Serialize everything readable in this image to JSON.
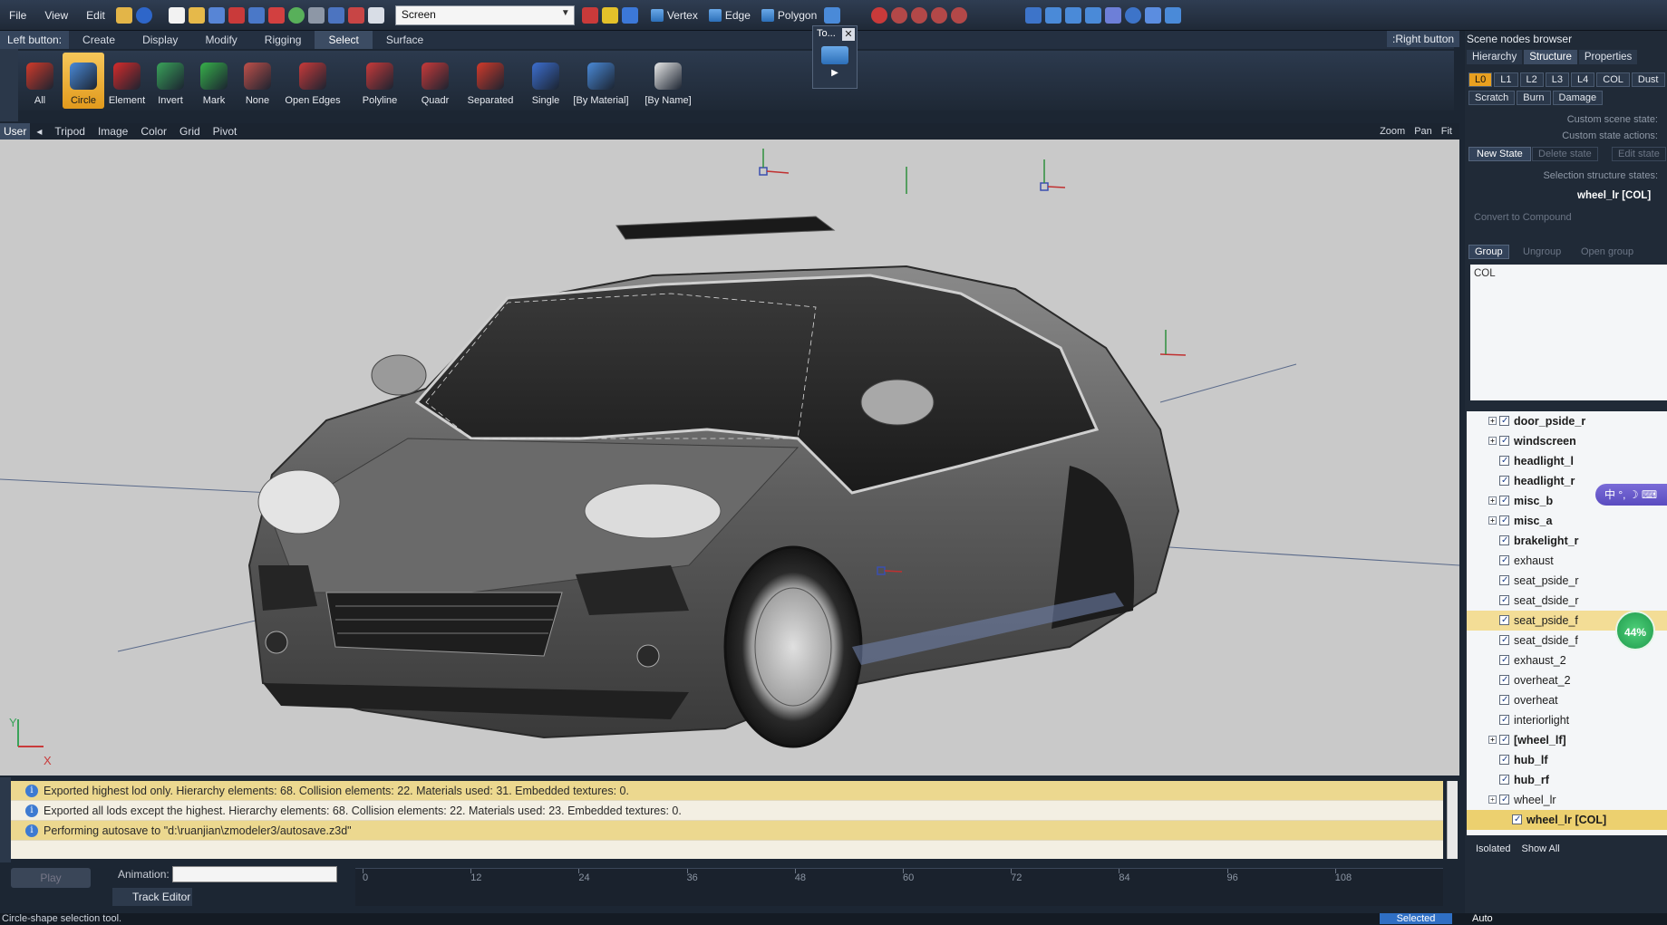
{
  "menu": [
    "File",
    "View",
    "Edit"
  ],
  "toolbar": {
    "screen_value": "Screen",
    "modes": [
      "Vertex",
      "Edge",
      "Polygon"
    ]
  },
  "ribbon": {
    "left_button_label": "Left button:",
    "right_button_label": ":Right button",
    "tabs": [
      "Create",
      "Display",
      "Modify",
      "Rigging",
      "Select",
      "Surface"
    ],
    "active_tab": "Select",
    "tools": [
      {
        "label": "All",
        "color": "#d23a2a"
      },
      {
        "label": "Circle",
        "color": "#4a8ad8"
      },
      {
        "label": "Element",
        "color": "#d62b2b"
      },
      {
        "label": "Invert",
        "color": "#3aa35a"
      },
      {
        "label": "Mark",
        "color": "#37b04a"
      },
      {
        "label": "None",
        "color": "#c0504a"
      },
      {
        "label": "Open Edges",
        "color": "#c93a3a"
      },
      {
        "label": "Polyline",
        "color": "#c93a3a"
      },
      {
        "label": "Quadr",
        "color": "#c93a3a"
      },
      {
        "label": "Separated",
        "color": "#d23a2a"
      },
      {
        "label": "Single",
        "color": "#3d6fd0"
      },
      {
        "label": "[By Material]",
        "color": "#4a8ad8"
      },
      {
        "label": "[By Name]",
        "color": "#e8e8e8"
      }
    ],
    "active_tool": "Circle",
    "toolbox_title": "To..."
  },
  "viewport_header": {
    "view_name": "User",
    "items": [
      "Tripod",
      "Image",
      "Color",
      "Grid",
      "Pivot"
    ],
    "right_items": [
      "Zoom",
      "Pan",
      "Fit"
    ]
  },
  "axis": {
    "x": "X",
    "y": "Y"
  },
  "log": [
    "Exported highest lod only. Hierarchy elements: 68. Collision elements: 22. Materials used: 31. Embedded textures: 0.",
    "Exported all lods except the highest. Hierarchy elements: 68. Collision elements: 22. Materials used: 23. Embedded textures: 0.",
    "Performing autosave to \"d:\\ruanjian\\zmodeler3/autosave.z3d\""
  ],
  "animation": {
    "play_label": "Play",
    "animation_label": "Animation:",
    "track_editor_label": "Track Editor",
    "ticks": [
      "0",
      "12",
      "24",
      "36",
      "48",
      "60",
      "72",
      "84",
      "96",
      "108"
    ]
  },
  "status": {
    "text": "Circle-shape selection tool.",
    "selected": "Selected",
    "auto": "Auto"
  },
  "scene_panel": {
    "title": "Scene nodes browser",
    "tabs": [
      "Hierarchy",
      "Structure",
      "Properties"
    ],
    "active_tab": "Structure",
    "lods": [
      "L0",
      "L1",
      "L2",
      "L3",
      "L4",
      "COL",
      "Dust"
    ],
    "damage_buttons": [
      "Scratch",
      "Burn",
      "Damage"
    ],
    "custom_scene_state": "Custom scene state:",
    "custom_state_actions": "Custom state actions:",
    "new_state": "New State",
    "delete_state": "Delete state",
    "edit_state": "Edit state",
    "selection_structure_states": "Selection structure states:",
    "selected_node": "wheel_lr [COL]",
    "convert_compound": "Convert to Compound",
    "group_buttons": [
      "Group",
      "Ungroup",
      "Open group"
    ],
    "col_text": "COL",
    "tree": [
      {
        "label": "door_pside_r",
        "bold": true,
        "expand": true
      },
      {
        "label": "windscreen",
        "bold": true,
        "expand": true
      },
      {
        "label": "headlight_l",
        "bold": true,
        "expand": false
      },
      {
        "label": "headlight_r",
        "bold": true,
        "expand": false
      },
      {
        "label": "misc_b",
        "bold": true,
        "expand": true
      },
      {
        "label": "misc_a",
        "bold": true,
        "expand": true
      },
      {
        "label": "brakelight_r",
        "bold": true,
        "expand": false
      },
      {
        "label": "exhaust",
        "bold": false,
        "expand": false
      },
      {
        "label": "seat_pside_r",
        "bold": false,
        "expand": false
      },
      {
        "label": "seat_dside_r",
        "bold": false,
        "expand": false
      },
      {
        "label": "seat_pside_f",
        "bold": false,
        "expand": false,
        "hl": true
      },
      {
        "label": "seat_dside_f",
        "bold": false,
        "expand": false
      },
      {
        "label": "exhaust_2",
        "bold": false,
        "expand": false
      },
      {
        "label": "overheat_2",
        "bold": false,
        "expand": false
      },
      {
        "label": "overheat",
        "bold": false,
        "expand": false
      },
      {
        "label": "interiorlight",
        "bold": false,
        "expand": false
      },
      {
        "label": "[wheel_lf]",
        "bold": true,
        "expand": true
      },
      {
        "label": "hub_lf",
        "bold": true,
        "expand": false
      },
      {
        "label": "hub_rf",
        "bold": true,
        "expand": false
      },
      {
        "label": "wheel_lr",
        "bold": false,
        "expand": true
      },
      {
        "label": "wheel_lr [COL]",
        "bold": true,
        "expand": false,
        "sel": true,
        "indent": true
      }
    ],
    "bottom": [
      "Isolated",
      "Show All"
    ]
  },
  "ime": "中 °, ☽ ⌨",
  "perf_badge": "44%"
}
